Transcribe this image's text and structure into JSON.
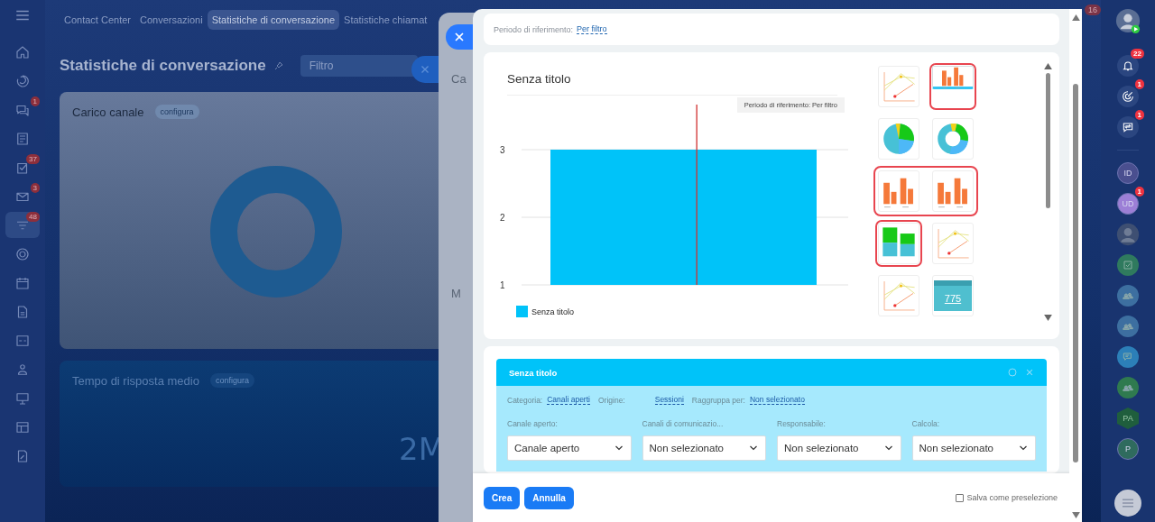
{
  "left_nav": {
    "items": [
      {
        "kind": "home",
        "selected": false
      },
      {
        "kind": "swirl",
        "selected": false
      },
      {
        "kind": "chat",
        "selected": false,
        "badge": "1"
      },
      {
        "kind": "feed",
        "selected": false
      },
      {
        "kind": "tasks",
        "selected": false,
        "badge": "37"
      },
      {
        "kind": "mail",
        "selected": false,
        "badge": "3"
      },
      {
        "kind": "filter",
        "selected": true,
        "badge": "48"
      },
      {
        "kind": "gear",
        "selected": false
      },
      {
        "kind": "calendar",
        "selected": false
      },
      {
        "kind": "document",
        "selected": false
      },
      {
        "kind": "drive",
        "selected": false
      },
      {
        "kind": "users",
        "selected": false
      },
      {
        "kind": "board",
        "selected": false
      },
      {
        "kind": "grid",
        "selected": false
      },
      {
        "kind": "sign",
        "selected": false
      }
    ]
  },
  "tabs": [
    {
      "label": "Contact Center",
      "selected": false
    },
    {
      "label": "Conversazioni",
      "selected": false
    },
    {
      "label": "Statistiche di conversazione",
      "selected": true
    },
    {
      "label": "Statistiche chiamat",
      "selected": false
    }
  ],
  "top_badge": "16",
  "page": {
    "title": "Statistiche di conversazione",
    "filter": {
      "placeholder": "Filtro"
    }
  },
  "cards": [
    {
      "kind": "donut",
      "title": "Carico canale",
      "action": "configura"
    },
    {
      "kind": "number",
      "title": "Tempo di risposta medio",
      "action": "configura",
      "value": "2M"
    }
  ],
  "back_slider": {
    "texts": [
      "Ca",
      "M"
    ]
  },
  "slider": {
    "period": {
      "label": "Periodo di riferimento:",
      "value": "Per filtro"
    },
    "chart": {
      "period_note": "Periodo di riferimento: Per filtro",
      "chart_data": {
        "type": "bar",
        "title": "Senza titolo",
        "ylim": [
          1,
          3
        ],
        "yticks": [
          1,
          2,
          3
        ],
        "series": [
          {
            "name": "Senza titolo",
            "color": "#00c3f9",
            "values": [
              3
            ]
          }
        ]
      }
    },
    "thumbnail_rows": [
      {
        "highlighted": false,
        "items": [
          {
            "kind": "line",
            "selected": false,
            "highlighted": false
          },
          {
            "kind": "bar",
            "selected": true,
            "highlighted": true
          }
        ]
      },
      {
        "highlighted": false,
        "items": [
          {
            "kind": "pie",
            "selected": false,
            "highlighted": false
          },
          {
            "kind": "donut",
            "selected": false,
            "highlighted": false
          }
        ]
      },
      {
        "highlighted": true,
        "items": [
          {
            "kind": "bar",
            "selected": false,
            "highlighted": false
          },
          {
            "kind": "bar",
            "selected": false,
            "highlighted": false
          }
        ]
      },
      {
        "highlighted": false,
        "items": [
          {
            "kind": "stacked",
            "selected": false,
            "highlighted": true
          },
          {
            "kind": "line",
            "selected": false,
            "highlighted": false
          }
        ]
      },
      {
        "highlighted": false,
        "items": [
          {
            "kind": "line",
            "selected": false,
            "highlighted": false
          },
          {
            "kind": "number",
            "selected": false,
            "highlighted": false,
            "value": "775"
          }
        ]
      }
    ],
    "report": {
      "title": "Senza titolo",
      "filters": [
        {
          "label": "Categoria:",
          "value": "Canali aperti"
        },
        {
          "label": "Origine:",
          "value": "Sessioni"
        },
        {
          "label": "Raggruppa per:",
          "value": "Non selezionato"
        }
      ],
      "selects": [
        {
          "label": "Canale aperto:",
          "value": "Canale aperto"
        },
        {
          "label": "Canali di comunicazio...",
          "value": "Non selezionato"
        },
        {
          "label": "Responsabile:",
          "value": "Non selezionato"
        },
        {
          "label": "Calcola:",
          "value": "Non selezionato"
        }
      ]
    },
    "buttons": [
      {
        "label": "Crea"
      },
      {
        "label": "Annulla"
      }
    ],
    "save_preset": {
      "label": "Salva come preselezione",
      "checked": false
    }
  },
  "right_bar": {
    "items": [
      {
        "kind": "photo"
      },
      {
        "kind": "bell",
        "badge": "22"
      },
      {
        "kind": "activity",
        "badge": "1"
      },
      {
        "kind": "swap",
        "badge": "1"
      },
      {
        "kind": "initials",
        "text": "ID",
        "color": "#4a4f8f"
      },
      {
        "kind": "initials",
        "text": "UD",
        "color": "#9c7fd6",
        "badge": "1"
      },
      {
        "kind": "photo2"
      },
      {
        "kind": "check"
      },
      {
        "kind": "group",
        "color": "#3d6fa0"
      },
      {
        "kind": "group",
        "color": "#3d6fa0"
      },
      {
        "kind": "chat"
      },
      {
        "kind": "group",
        "color": "#2f7a4f"
      },
      {
        "kind": "hexagon",
        "text": "PA"
      },
      {
        "kind": "initials",
        "text": "P",
        "color": "#2f6b5e"
      },
      {
        "kind": "menu"
      }
    ]
  }
}
